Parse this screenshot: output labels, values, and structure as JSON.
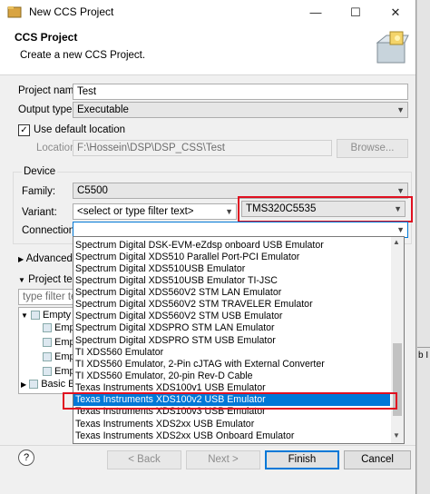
{
  "window": {
    "title": "New CCS Project",
    "minimize": "—",
    "maximize": "☐",
    "close": "✕"
  },
  "header": {
    "title": "CCS Project",
    "description": "Create a new CCS Project."
  },
  "form": {
    "project_name_label": "Project name:",
    "project_name_value": "Test",
    "output_type_label": "Output type:",
    "output_type_value": "Executable",
    "use_default_location_label": "Use default location",
    "location_label": "Location:",
    "location_value": "F:\\Hossein\\DSP\\DSP_CSS\\Test",
    "browse_label": "Browse..."
  },
  "device": {
    "group_label": "Device",
    "family_label": "Family:",
    "family_value": "C5500",
    "variant_label": "Variant:",
    "variant_filter_placeholder": "<select or type filter text>",
    "variant_value": "TMS320C5535",
    "connection_label": "Connection:"
  },
  "advanced_label": "Advanced s",
  "project_templates": {
    "label": "Project tem",
    "filter_placeholder": "type filter tex",
    "tree": [
      "Empty",
      "Empt",
      "Emp",
      "Emp",
      "Emp",
      "Basic E"
    ]
  },
  "connection_options": [
    "Spectrum Digital DSK-EVM-eZdsp onboard USB Emulator",
    "Spectrum Digital XDS510 Parallel Port-PCI  Emulator",
    "Spectrum Digital XDS510USB Emulator",
    "Spectrum Digital XDS510USB Emulator TI-JSC",
    "Spectrum Digital XDS560V2 STM LAN Emulator",
    "Spectrum Digital XDS560V2 STM TRAVELER Emulator",
    "Spectrum Digital XDS560V2 STM USB Emulator",
    "Spectrum Digital XDSPRO STM LAN Emulator",
    "Spectrum Digital XDSPRO STM USB Emulator",
    "TI XDS560 Emulator",
    "TI XDS560 Emulator, 2-Pin cJTAG with External Converter",
    "TI XDS560 Emulator, 20-pin Rev-D Cable",
    "Texas Instruments XDS100v1 USB Emulator",
    "Texas Instruments XDS100v2 USB Emulator",
    "Texas Instruments XDS100v3 USB Emulator",
    "Texas Instruments XDS2xx USB Emulator",
    "Texas Instruments XDS2xx USB Onboard Emulator"
  ],
  "selected_connection_index": 13,
  "buttons": {
    "help": "?",
    "back": "< Back",
    "next": "Next >",
    "finish": "Finish",
    "cancel": "Cancel"
  },
  "background_fragment": "b I",
  "colors": {
    "selection": "#0078d7",
    "highlight_box": "#e01020"
  }
}
